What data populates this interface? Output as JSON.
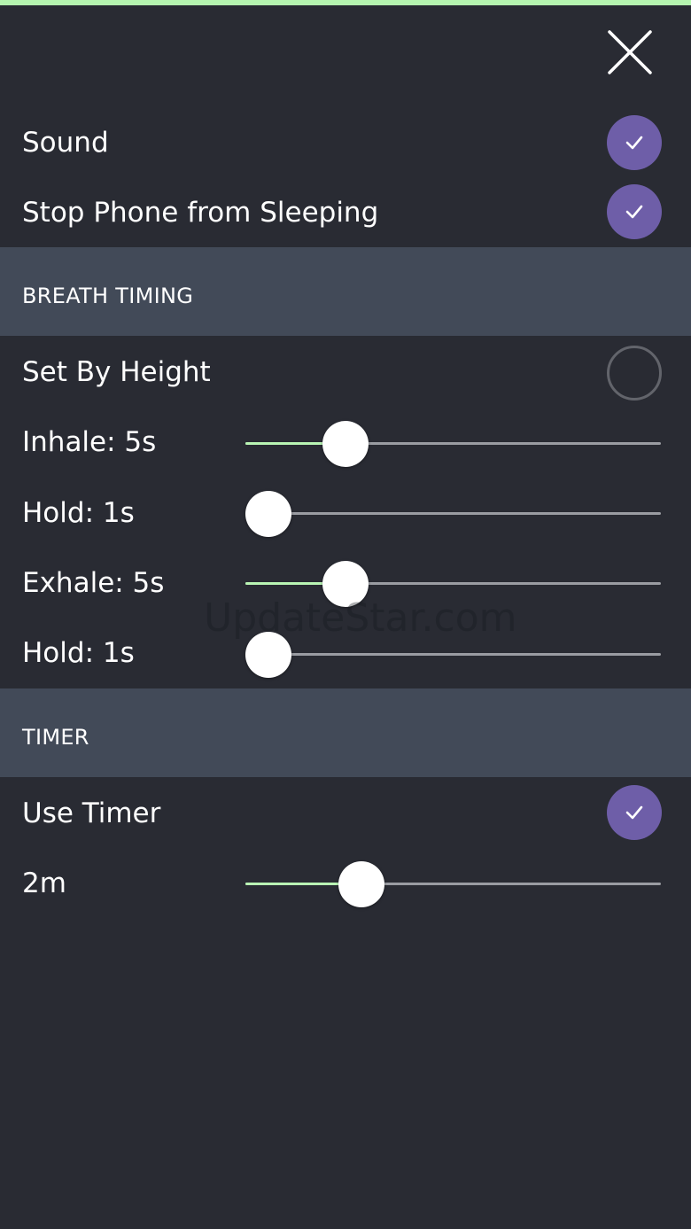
{
  "colors": {
    "accent": "#6e5ea8",
    "slider_fill": "#b9f5b4",
    "section_bg": "#424a58",
    "background": "#292b33"
  },
  "settings": {
    "sound": {
      "label": "Sound",
      "checked": true
    },
    "stop_sleep": {
      "label": "Stop Phone from Sleeping",
      "checked": true
    }
  },
  "breath_timing": {
    "title": "BREATH TIMING",
    "set_by_height": {
      "label": "Set By Height",
      "checked": false
    },
    "inhale": {
      "label": "Inhale: 5s",
      "level": 0.24
    },
    "hold1": {
      "label": "Hold: 1s",
      "level": 0.05
    },
    "exhale": {
      "label": "Exhale: 5s",
      "level": 0.24
    },
    "hold2": {
      "label": "Hold: 1s",
      "level": 0.05
    }
  },
  "timer": {
    "title": "TIMER",
    "use_timer": {
      "label": "Use Timer",
      "checked": true
    },
    "duration": {
      "label": "2m",
      "level": 0.28
    }
  },
  "watermark": "UpdateStar.com",
  "icons": {
    "close": "close-icon",
    "check": "check-icon"
  }
}
